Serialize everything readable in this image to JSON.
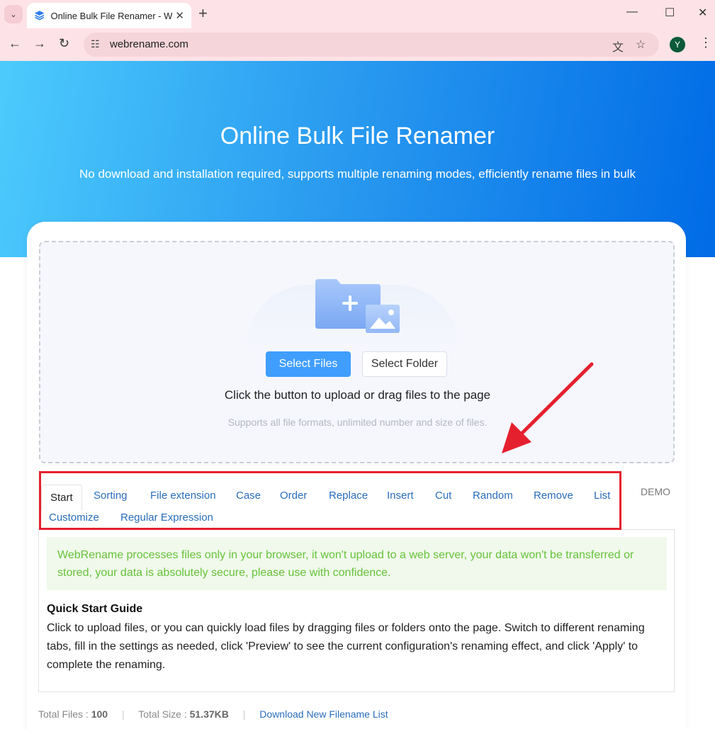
{
  "browser": {
    "tab_title": "Online Bulk File Renamer - W",
    "url": "webrename.com",
    "profile_initial": "Y"
  },
  "hero": {
    "title": "Online Bulk File Renamer",
    "subtitle": "No download and installation required, supports multiple renaming modes, efficiently rename files in bulk"
  },
  "upload": {
    "select_files": "Select Files",
    "select_folder": "Select Folder",
    "instruction": "Click the button to upload or drag files to the page",
    "note": "Supports all file formats, unlimited number and size of files."
  },
  "tabs": [
    {
      "label": "Start",
      "active": true
    },
    {
      "label": "Sorting"
    },
    {
      "label": "File extension"
    },
    {
      "label": "Case"
    },
    {
      "label": "Order"
    },
    {
      "label": "Replace"
    },
    {
      "label": "Insert"
    },
    {
      "label": "Cut"
    },
    {
      "label": "Random"
    },
    {
      "label": "Remove"
    },
    {
      "label": "List"
    },
    {
      "label": "Customize"
    },
    {
      "label": "Regular Expression"
    }
  ],
  "demo_label": "DEMO",
  "notice": "WebRename processes files only in your browser, it won't upload to a web server, your data won't be transferred or stored, your data is absolutely secure, please use with confidence.",
  "quick_start": {
    "title": "Quick Start Guide",
    "text": "Click to upload files, or you can quickly load files by dragging files or folders onto the page. Switch to different renaming tabs, fill in the settings as needed, click 'Preview' to see the current configuration's renaming effect, and click 'Apply' to complete the renaming."
  },
  "footer": {
    "total_files_label": "Total Files : ",
    "total_files": "100",
    "total_size_label": "Total Size : ",
    "total_size": "51.37KB",
    "download_link": "Download New Filename List"
  },
  "colors": {
    "accent": "#409eff",
    "annotation": "#e5202e",
    "notice_text": "#67c23a"
  }
}
